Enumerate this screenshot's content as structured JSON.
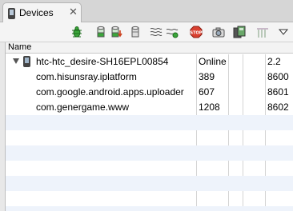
{
  "tab": {
    "title": "Devices"
  },
  "toolbar": {
    "buttons": [
      "debug-process-icon",
      "update-heap-icon",
      "dump-hprof-icon",
      "gc-icon",
      "update-threads-icon",
      "start-method-profiling-icon",
      "stop-process-icon",
      "screen-capture-icon",
      "dump-view-hierarchy-icon",
      "systrace-icon",
      "view-menu-icon"
    ]
  },
  "table": {
    "column_name": "Name",
    "device": {
      "name": "htc-htc_desire-SH16EPL00854",
      "status": "Online",
      "version": "2.2"
    },
    "processes": [
      {
        "name": "com.hisunsray.iplatform",
        "pid": "389",
        "port": "8600"
      },
      {
        "name": "com.google.android.apps.uploader",
        "pid": "607",
        "port": "8601"
      },
      {
        "name": "com.genergame.www",
        "pid": "1208",
        "port": "8602"
      }
    ]
  }
}
